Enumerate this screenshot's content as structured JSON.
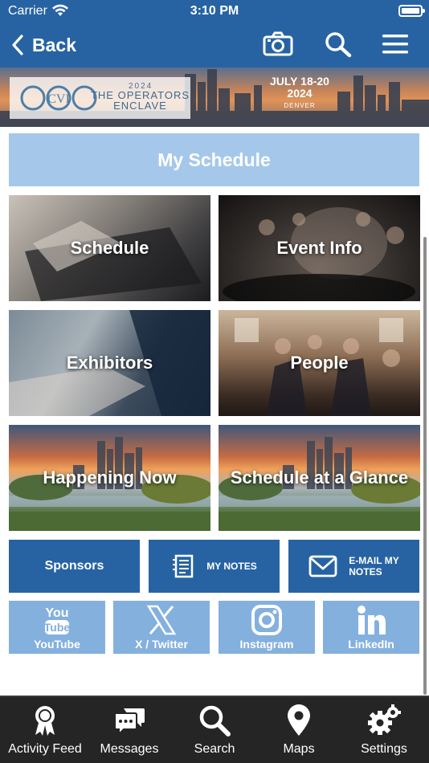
{
  "status_bar": {
    "carrier": "Carrier",
    "time": "3:10 PM"
  },
  "nav": {
    "back_label": "Back",
    "icons": [
      "camera-icon",
      "search-icon",
      "menu-icon"
    ]
  },
  "banner": {
    "logo_text": "CVI",
    "year": "2024",
    "event_name": "THE OPERATORS ENCLAVE",
    "dates": "JULY 18-20",
    "date_year": "2024",
    "location": "DENVER"
  },
  "content": {
    "my_schedule": "My Schedule",
    "tiles": [
      "Schedule",
      "Event Info",
      "Exhibitors",
      "People",
      "Happening Now",
      "Schedule at a Glance"
    ],
    "sponsors": "Sponsors",
    "my_notes": "MY NOTES",
    "email_notes_line1": "E-MAIL MY",
    "email_notes_line2": "NOTES",
    "social": [
      "YouTube",
      "X / Twitter",
      "Instagram",
      "LinkedIn"
    ]
  },
  "tabbar": {
    "items": [
      "Activity Feed",
      "Messages",
      "Search",
      "Maps",
      "Settings"
    ]
  },
  "colors": {
    "primary": "#2763a3",
    "light_blue": "#a5c8ea",
    "social_blue": "#84b0de",
    "tabbar_bg": "#252525"
  }
}
